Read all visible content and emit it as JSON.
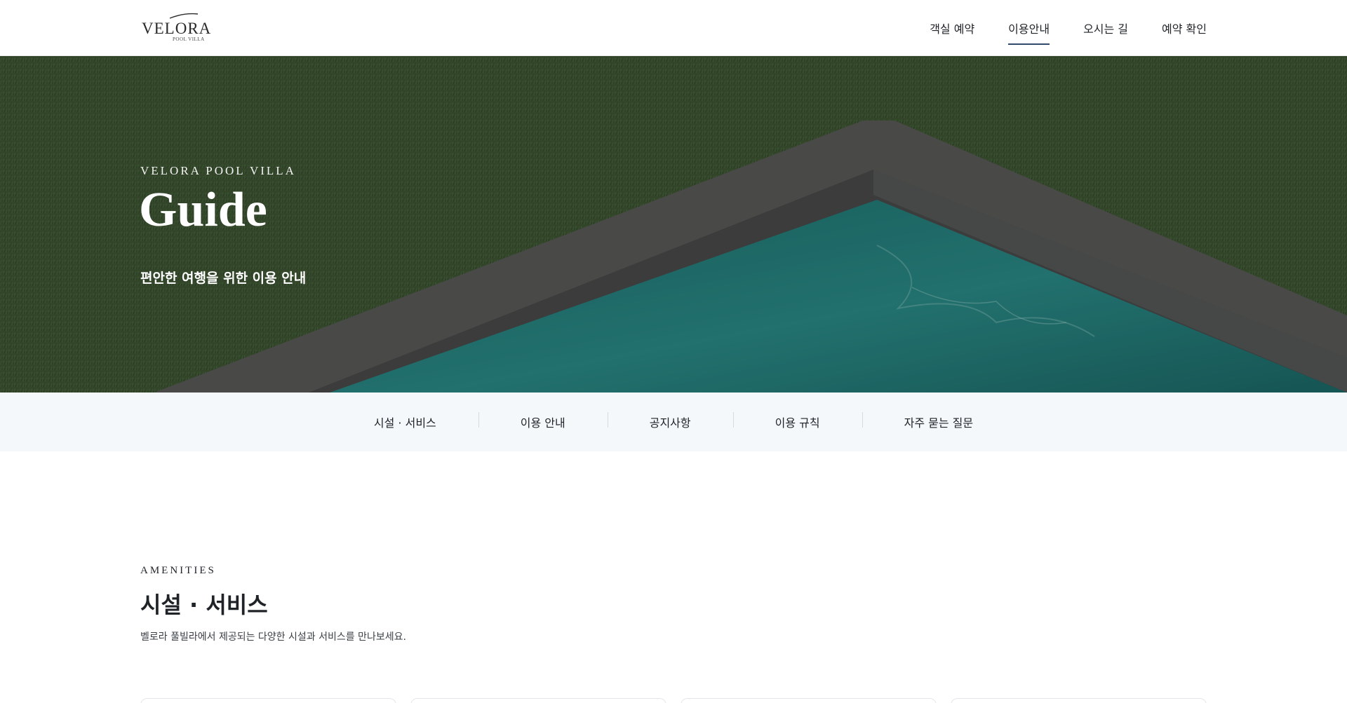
{
  "header": {
    "logo": {
      "word": "VELORA",
      "sub": "POOL VILLA"
    },
    "nav": [
      {
        "label": "객실 예약",
        "active": false
      },
      {
        "label": "이용안내",
        "active": true
      },
      {
        "label": "오시는 길",
        "active": false
      },
      {
        "label": "예약 확인",
        "active": false
      }
    ]
  },
  "hero": {
    "eyebrow": "VELORA POOL VILLA",
    "title": "Guide",
    "subtitle": "편안한 여행을 위한 이용 안내"
  },
  "subnav": {
    "items": [
      "시설 · 서비스",
      "이용 안내",
      "공지사항",
      "이용 규칙",
      "자주 묻는 질문"
    ]
  },
  "section": {
    "eyebrow": "AMENITIES",
    "title": "시설 · 서비스",
    "description": "벨로라 풀빌라에서 제공되는 다양한 시설과 서비스를 만나보세요."
  },
  "colors": {
    "accent": "#2f4a6a",
    "grass": "#3b5130",
    "pool": "#1f7c7a",
    "subnav_bg": "#f4f8fb"
  }
}
